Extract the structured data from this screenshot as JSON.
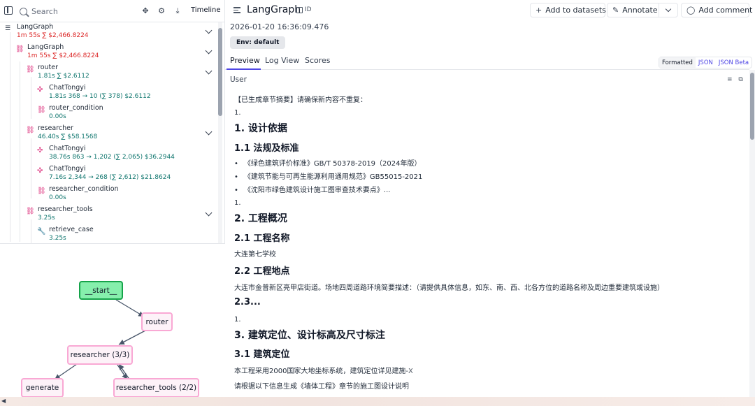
{
  "toolbar": {
    "search_placeholder": "Search",
    "timeline_label": "Timeline"
  },
  "tree": [
    {
      "name": "LangGraph",
      "meta": "1m 55s  ∑ $2,466.8224",
      "icon": "list-icon",
      "meta_color": "red"
    },
    {
      "name": "LangGraph",
      "meta": "1m 55s  ∑ $2,466.8224",
      "icon": "link-icon",
      "meta_color": "red"
    },
    {
      "name": "router",
      "meta": "1.81s  ∑ $2.6112",
      "icon": "link-icon"
    },
    {
      "name": "ChatTongyi",
      "meta": "1.81s  368 → 10 (∑ 378)  $2.6112",
      "icon": "llm-icon"
    },
    {
      "name": "router_condition",
      "meta": "0.00s",
      "icon": "link-icon"
    },
    {
      "name": "researcher",
      "meta": "46.40s  ∑ $58.1568",
      "icon": "link-icon"
    },
    {
      "name": "ChatTongyi",
      "meta": "38.76s  863 → 1,202 (∑ 2,065)  $36.2944",
      "icon": "llm-icon"
    },
    {
      "name": "ChatTongyi",
      "meta": "7.16s  2,344 → 268 (∑ 2,612)  $21.8624",
      "icon": "llm-icon"
    },
    {
      "name": "researcher_condition",
      "meta": "0.00s",
      "icon": "link-icon"
    },
    {
      "name": "researcher_tools",
      "meta": "3.25s",
      "icon": "link-icon"
    },
    {
      "name": "retrieve_case",
      "meta": "3.25s",
      "icon": "tool-icon"
    }
  ],
  "graph": {
    "start": "__start__",
    "router": "router",
    "researcher": "researcher (3/3)",
    "generate": "generate",
    "researcher_tools": "researcher_tools (2/2)"
  },
  "header": {
    "title": "LangGraph",
    "id_label": "ID",
    "add_to_datasets": "Add to datasets",
    "annotate": "Annotate",
    "add_comment": "Add comment",
    "timestamp": "2026-01-20 16:36:09.476",
    "env": "Env: default"
  },
  "tabs": [
    "Preview",
    "Log View",
    "Scores"
  ],
  "format_options": [
    "Formatted",
    "JSON",
    "JSON Beta"
  ],
  "message": {
    "role": "User",
    "lines": [
      {
        "t": "p",
        "text": "【已生成章节摘要】请确保新内容不重复："
      },
      {
        "t": "p",
        "text": "1."
      },
      {
        "t": "h1",
        "text": "1. 设计依据"
      },
      {
        "t": "h2",
        "text": "1.1 法规及标准"
      },
      {
        "t": "li",
        "text": "《绿色建筑评价标准》GB/T 50378-2019（2024年版）"
      },
      {
        "t": "li",
        "text": "《建筑节能与可再生能源利用通用规范》GB55015-2021"
      },
      {
        "t": "li",
        "text": "《沈阳市绿色建筑设计施工图审查技术要点》..."
      },
      {
        "t": "p",
        "text": "1."
      },
      {
        "t": "h1",
        "text": "2. 工程概况"
      },
      {
        "t": "h2",
        "text": "2.1 工程名称"
      },
      {
        "t": "p",
        "text": "大连第七学校"
      },
      {
        "t": "h2",
        "text": "2.2 工程地点"
      },
      {
        "t": "p",
        "text": "大连市金普新区亮甲店街道。场地四周道路环境简要描述：（请提供具体信息，如东、南、西、北各方位的道路名称及周边重要建筑或设施）"
      },
      {
        "t": "h2",
        "text": "2.3..."
      },
      {
        "t": "p",
        "text": "1."
      },
      {
        "t": "h1",
        "text": "3. 建筑定位、设计标高及尺寸标注"
      },
      {
        "t": "h2",
        "text": "3.1 建筑定位"
      },
      {
        "t": "p",
        "text": "本工程采用2000国家大地坐标系统，建筑定位详见建施-X"
      },
      {
        "t": "p",
        "text": "请根据以下信息生成《墙体工程》章节的施工图设计说明"
      }
    ]
  }
}
